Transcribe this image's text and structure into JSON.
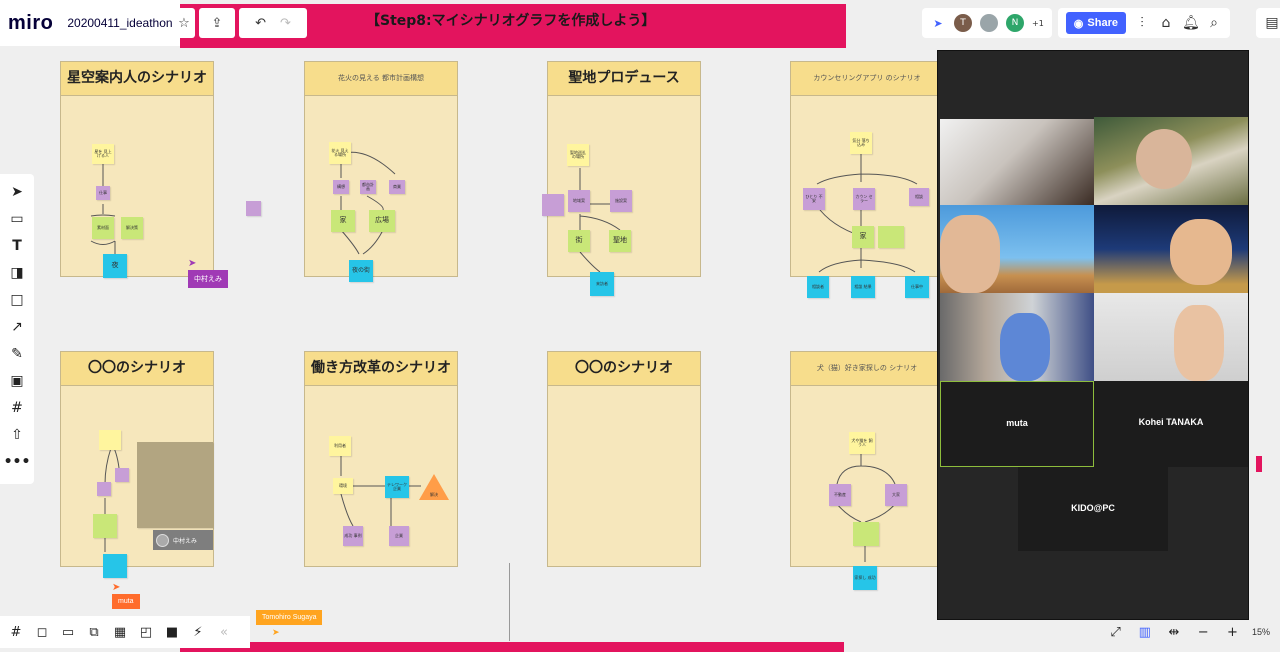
{
  "app": {
    "logo": "miro",
    "board_name": "20200411_ideathon"
  },
  "banner": {
    "title": "【Step8:マイシナリオグラフを作成しよう】"
  },
  "topbar": {
    "users": [
      {
        "initial": "T",
        "color": "#7a5c4a"
      },
      {
        "initial": "",
        "color": "#9aa5a9"
      },
      {
        "initial": "N",
        "color": "#2ea66a"
      }
    ],
    "more_users": "+1",
    "share_label": "Share"
  },
  "frames": [
    {
      "title": "星空案内人のシナリオ",
      "small": false
    },
    {
      "title": "花火の見える 都市計画構想",
      "small": true
    },
    {
      "title": "聖地プロデュース",
      "small": false
    },
    {
      "title": "カウンセリングアプリ のシナリオ",
      "small": true
    },
    {
      "title": "〇〇のシナリオ",
      "small": false
    },
    {
      "title": "働き方改革のシナリオ",
      "small": false
    },
    {
      "title": "〇〇のシナリオ",
      "small": false
    },
    {
      "title": "犬（猫）好き家探しの シナリオ",
      "small": true
    }
  ],
  "frame_notes": {
    "f1": [
      "星を 見上げる人",
      "仕事",
      "素材面",
      "解決策",
      "夜"
    ],
    "f2": [
      "花火 見える場所",
      "構想",
      "都市計画",
      "商業",
      "家",
      "広場",
      "夜の街"
    ],
    "f3": [
      "聖地巡礼 の場所",
      "地域案",
      "施設案",
      "街",
      "聖地",
      "来訪者",
      "外国人"
    ],
    "f4": [
      "気分 落ち込み",
      "ひとり 不安",
      "カウン セラー",
      "相談",
      "家",
      "",
      "相談者 ",
      "相談 結果",
      "仕事中"
    ],
    "f5": [
      "",
      "",
      "",
      "",
      "",
      "",
      "中村えみ"
    ],
    "f6": [
      "利用者",
      "環境",
      "テレワーク 企業",
      "成功 事例",
      "企業",
      "施設",
      "解決"
    ],
    "f8": [
      "犬や猫を 飼う人",
      "不動産",
      "大家",
      "",
      "家探し 成功"
    ]
  },
  "cursors": {
    "nakamura": "中村えみ",
    "muta": "muta",
    "sugaya": "Tomohiro Sugaya"
  },
  "video": {
    "names": [
      "muta",
      "Kohei TANAKA",
      "KIDO@PC"
    ]
  },
  "zoom": "15%"
}
